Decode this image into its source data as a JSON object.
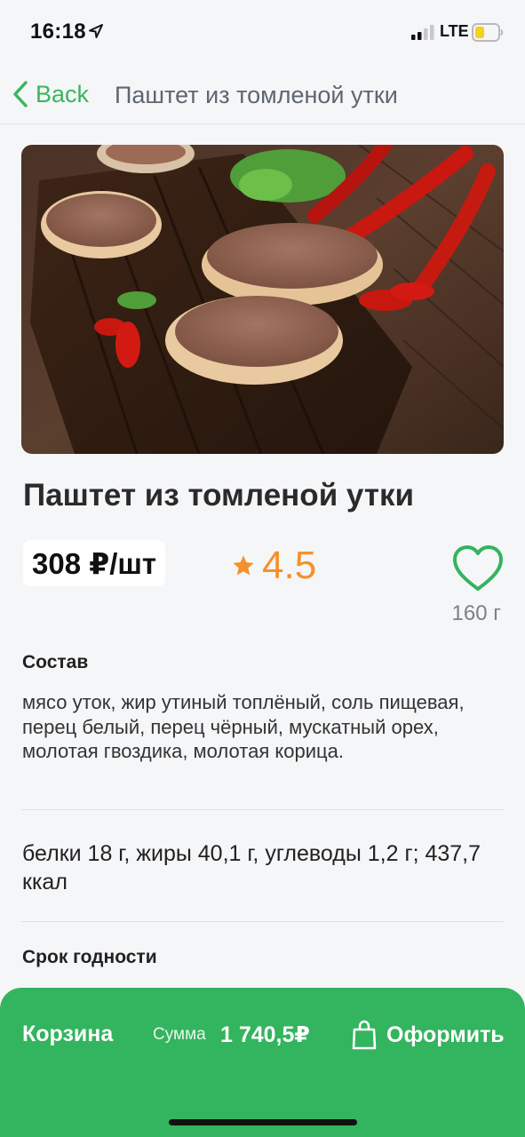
{
  "status_bar": {
    "time": "16:18",
    "network": "LTE",
    "icons": [
      "location-arrow-icon",
      "signal-icon",
      "battery-icon"
    ]
  },
  "nav": {
    "back_label": "Back",
    "title": "Паштет из томленой утки",
    "icons": [
      "chevron-left-icon"
    ]
  },
  "product": {
    "image": "duck-pate-photo",
    "title": "Паштет из томленой утки",
    "price": "308 ₽/шт",
    "rating": "4.5",
    "weight": "160 г",
    "icons": [
      "star-icon",
      "heart-icon"
    ]
  },
  "details": {
    "composition_label": "Состав",
    "composition": "мясо уток, жир утиный топлёный, соль пищевая, перец белый, перец чёрный, мускатный орех, молотая гвоздика, молотая корица.",
    "nutrition": "белки 18 г, жиры 40,1 г, углеводы 1,2 г; 437,7 ккал",
    "shelf_life_label": "Срок годности"
  },
  "cart": {
    "label": "Корзина",
    "sum_label": "Сумма",
    "sum_value": "1 740,5₽",
    "checkout_label": "Оформить",
    "icons": [
      "shopping-bag-icon"
    ]
  },
  "colors": {
    "accent_green": "#33b45e",
    "link_green": "#3bb55f",
    "rating_orange": "#f5912a",
    "background": "#f5f6f8"
  }
}
